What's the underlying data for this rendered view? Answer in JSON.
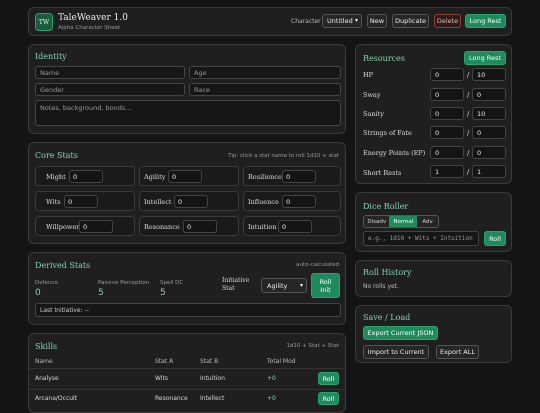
{
  "header": {
    "logo_initials": "TW",
    "app_title": "TaleWeaver 1.0",
    "subtitle": "Alpha Character Sheet",
    "character_label": "Character",
    "character_select_value": "Untitled",
    "new_label": "New",
    "duplicate_label": "Duplicate",
    "delete_label": "Delete",
    "long_rest_label": "Long Rest"
  },
  "identity": {
    "title": "Identity",
    "name_placeholder": "Name",
    "age_placeholder": "Age",
    "gender_placeholder": "Gender",
    "race_placeholder": "Race",
    "notes_placeholder": "Notes, background, bonds..."
  },
  "core_stats": {
    "title": "Core Stats",
    "tip": "Tip: click a stat name to roll 1d10 + stat",
    "stats": [
      {
        "name": "Might",
        "value": "0"
      },
      {
        "name": "Agility",
        "value": "0"
      },
      {
        "name": "Resilience",
        "value": "0"
      },
      {
        "name": "Wits",
        "value": "0"
      },
      {
        "name": "Intellect",
        "value": "0"
      },
      {
        "name": "Influence",
        "value": "0"
      },
      {
        "name": "Willpower",
        "value": "0"
      },
      {
        "name": "Resonance",
        "value": "0"
      },
      {
        "name": "Intuition",
        "value": "0"
      }
    ]
  },
  "derived": {
    "title": "Derived Stats",
    "note": "auto-calculated",
    "defence_label": "Defence",
    "defence_value": "0",
    "perception_label": "Passive Perception",
    "perception_value": "5",
    "spelldc_label": "Spell DC",
    "spelldc_value": "5",
    "initiative_label": "Initiative Stat",
    "initiative_select": "Agility",
    "roll_init_label": "Roll Init",
    "last_initiative": "Last Initiative: --"
  },
  "skills": {
    "title": "Skills",
    "note": "1d10 + Stat + Stat",
    "columns": [
      "Name",
      "Stat A",
      "Stat B",
      "Total Mod"
    ],
    "rows": [
      {
        "name": "Analyse",
        "a": "Wits",
        "b": "Intuition",
        "mod": "+0",
        "roll": "Roll"
      },
      {
        "name": "Arcana/Occult",
        "a": "Resonance",
        "b": "Intellect",
        "mod": "+0",
        "roll": "Roll"
      }
    ]
  },
  "resources": {
    "title": "Resources",
    "long_rest_label": "Long Rest",
    "items": [
      {
        "name": "HP",
        "current": "0",
        "sep": "/",
        "max": "10"
      },
      {
        "name": "Sway",
        "current": "0",
        "sep": "/",
        "max": "0"
      },
      {
        "name": "Sanity",
        "current": "0",
        "sep": "/",
        "max": "10"
      },
      {
        "name": "Strings of Fate",
        "current": "0",
        "sep": "/",
        "max": "0"
      },
      {
        "name": "Energy Points (EP)",
        "current": "0",
        "sep": "/",
        "max": "0"
      },
      {
        "name": "Short Rests",
        "current": "1",
        "sep": "/",
        "max": "1"
      }
    ]
  },
  "dice": {
    "title": "Dice Roller",
    "modes": [
      "Disadv",
      "Normal",
      "Adv"
    ],
    "active_mode": "Normal",
    "input_placeholder": "e.g., 1d10 + Wits + Intuition",
    "roll_label": "Roll"
  },
  "history": {
    "title": "Roll History",
    "empty_text": "No rolls yet."
  },
  "save": {
    "title": "Save / Load",
    "export_json_label": "Export Current JSON",
    "import_label": "Import to Current",
    "export_all_label": "Export ALL"
  },
  "colors": {
    "accent": "#8ad3b0",
    "button_green": "#1f8a5c",
    "danger": "#9b3b3b",
    "background": "#141414",
    "panel": "#1f1f1f"
  }
}
